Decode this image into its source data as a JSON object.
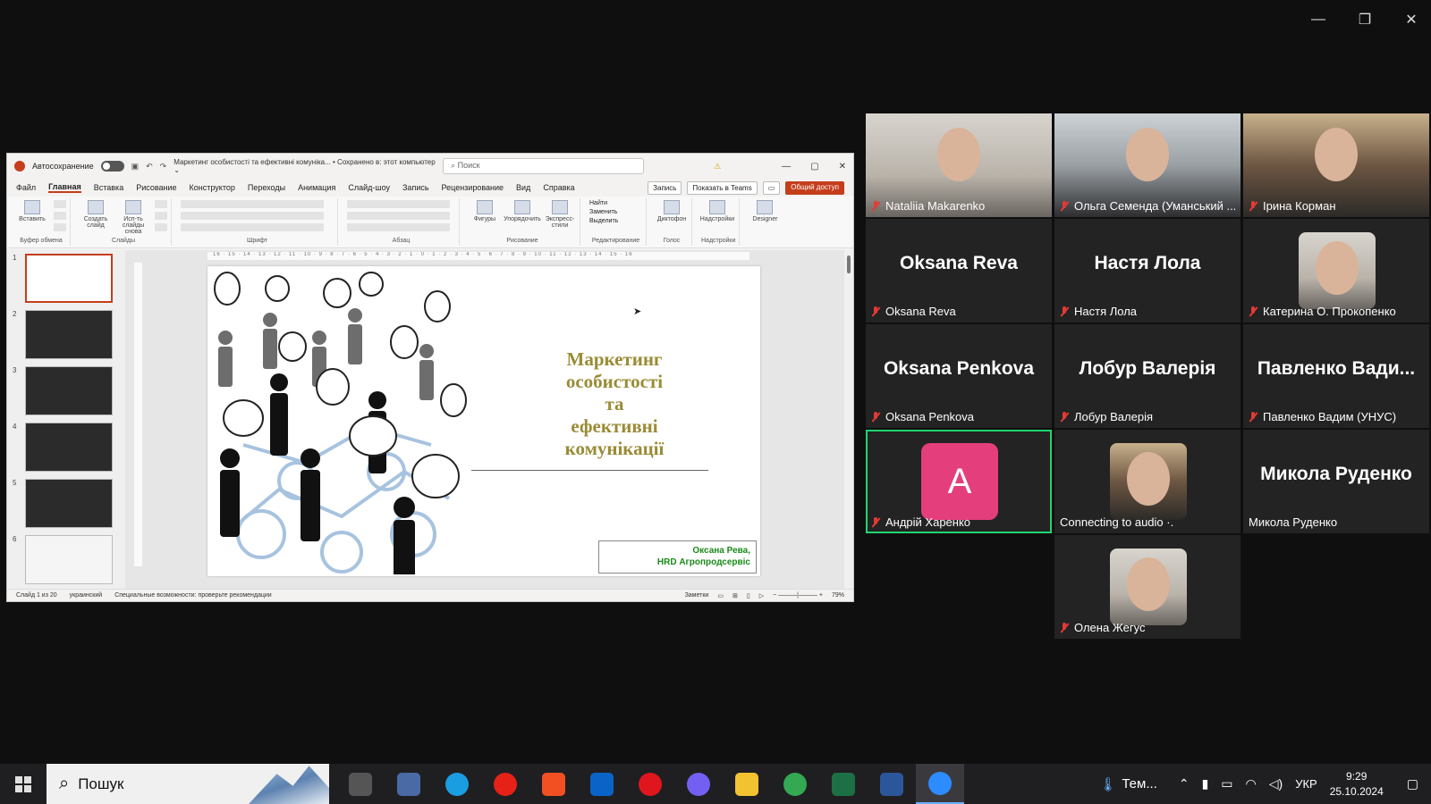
{
  "window_controls": {
    "minimize": "—",
    "restore": "❐",
    "close": "✕"
  },
  "ppt": {
    "autosave_label": "Автосохранение",
    "document_title": "Маркетинг особистості та ефективні комуніка... • Сохранено в: этот компьютер ⌄",
    "search_placeholder": "Поиск",
    "tabs": [
      "Файл",
      "Главная",
      "Вставка",
      "Рисование",
      "Конструктор",
      "Переходы",
      "Анимация",
      "Слайд-шоу",
      "Запись",
      "Рецензирование",
      "Вид",
      "Справка"
    ],
    "active_tab": "Главная",
    "record_button": "Запись",
    "teams_button": "Показать в Teams",
    "share_button": "Общий доступ",
    "ribbon_groups": [
      "Буфер обмена",
      "Слайды",
      "Шрифт",
      "Абзац",
      "Рисование",
      "Редактирование",
      "Голос",
      "Надстройки"
    ],
    "ribbon_buttons": {
      "paste": "Вставить",
      "new_slide": "Создать слайд",
      "reuse": "Исп-ть слайды снова",
      "shapes": "Фигуры",
      "arrange": "Упорядочить",
      "express": "Экспресс-стили",
      "find": "Найти",
      "replace": "Заменить",
      "select": "Выделить",
      "dictate": "Диктофон",
      "addins": "Надстройки",
      "designer": "Designer"
    },
    "thumbnail_numbers": [
      "1",
      "2",
      "3",
      "4",
      "5",
      "6"
    ],
    "ruler_text": "16 · 15 · 14 · 13 · 12 · 11 · 10 · 9 · 8 · 7 · 6 · 5 · 4 · 3 · 2 · 1 · 0 · 1 · 2 · 3 · 4 · 5 · 6 · 7 · 8 · 9 · 10 · 11 · 12 · 13 · 14 · 15 · 16",
    "slide": {
      "title_lines": [
        "Маркетинг",
        "особистості",
        "та",
        "ефективні",
        "комунікації"
      ],
      "author_name": "Оксана Рева,",
      "author_role": "HRD Агропродсервіс"
    },
    "status": {
      "slide_count": "Слайд 1 из 20",
      "language": "украинский",
      "accessibility": "Специальные возможности: проверьте рекомендации",
      "notes": "Заметки",
      "zoom": "79%"
    }
  },
  "participants": [
    {
      "name": "Nataliia Makarenko",
      "type": "video",
      "muted": true
    },
    {
      "name": "Ольга Семенда (Уманський ...",
      "type": "video",
      "muted": true
    },
    {
      "name": "Ірина Корман",
      "type": "video",
      "muted": true
    },
    {
      "name": "Oksana Reva",
      "display": "Oksana Reva",
      "type": "name",
      "muted": true
    },
    {
      "name": "Настя Лола",
      "display": "Настя Лола",
      "type": "name",
      "muted": true
    },
    {
      "name": "Катерина О. Прокопенко",
      "type": "avatar",
      "muted": true
    },
    {
      "name": "Oksana Penkova",
      "display": "Oksana Penkova",
      "type": "name",
      "muted": true
    },
    {
      "name": "Лобур Валерія",
      "display": "Лобур Валерія",
      "type": "name",
      "muted": true
    },
    {
      "name": "Павленко Вадим (УНУС)",
      "display": "Павленко Вади...",
      "type": "name",
      "muted": true
    },
    {
      "name": "Андрій Харенко",
      "letter": "A",
      "type": "letter",
      "muted": true,
      "speaking": true
    },
    {
      "name": "Connecting to audio ·.",
      "type": "avatar",
      "muted": false
    },
    {
      "name": "Микола Руденко",
      "display": "Микола Руденко",
      "type": "name",
      "muted": false
    },
    {
      "name": "Олена Жегус",
      "type": "avatar",
      "muted": true
    }
  ],
  "taskbar": {
    "search_text": "Пошук",
    "apps": [
      "task-view",
      "calculator",
      "edge",
      "youtube",
      "microsoft-store",
      "outlook",
      "opera",
      "viber",
      "file-explorer",
      "chrome",
      "excel",
      "word",
      "zoom"
    ],
    "active_app": "zoom",
    "weather": "Тем...",
    "language": "УКР",
    "time": "9:29",
    "date": "25.10.2024"
  },
  "colors": {
    "accent_ppt": "#c43e1c",
    "slide_title": "#9a8b35",
    "speaking_border": "#1fd66e",
    "letter_avatar": "#e43f7c",
    "muted_icon": "#e53935"
  }
}
